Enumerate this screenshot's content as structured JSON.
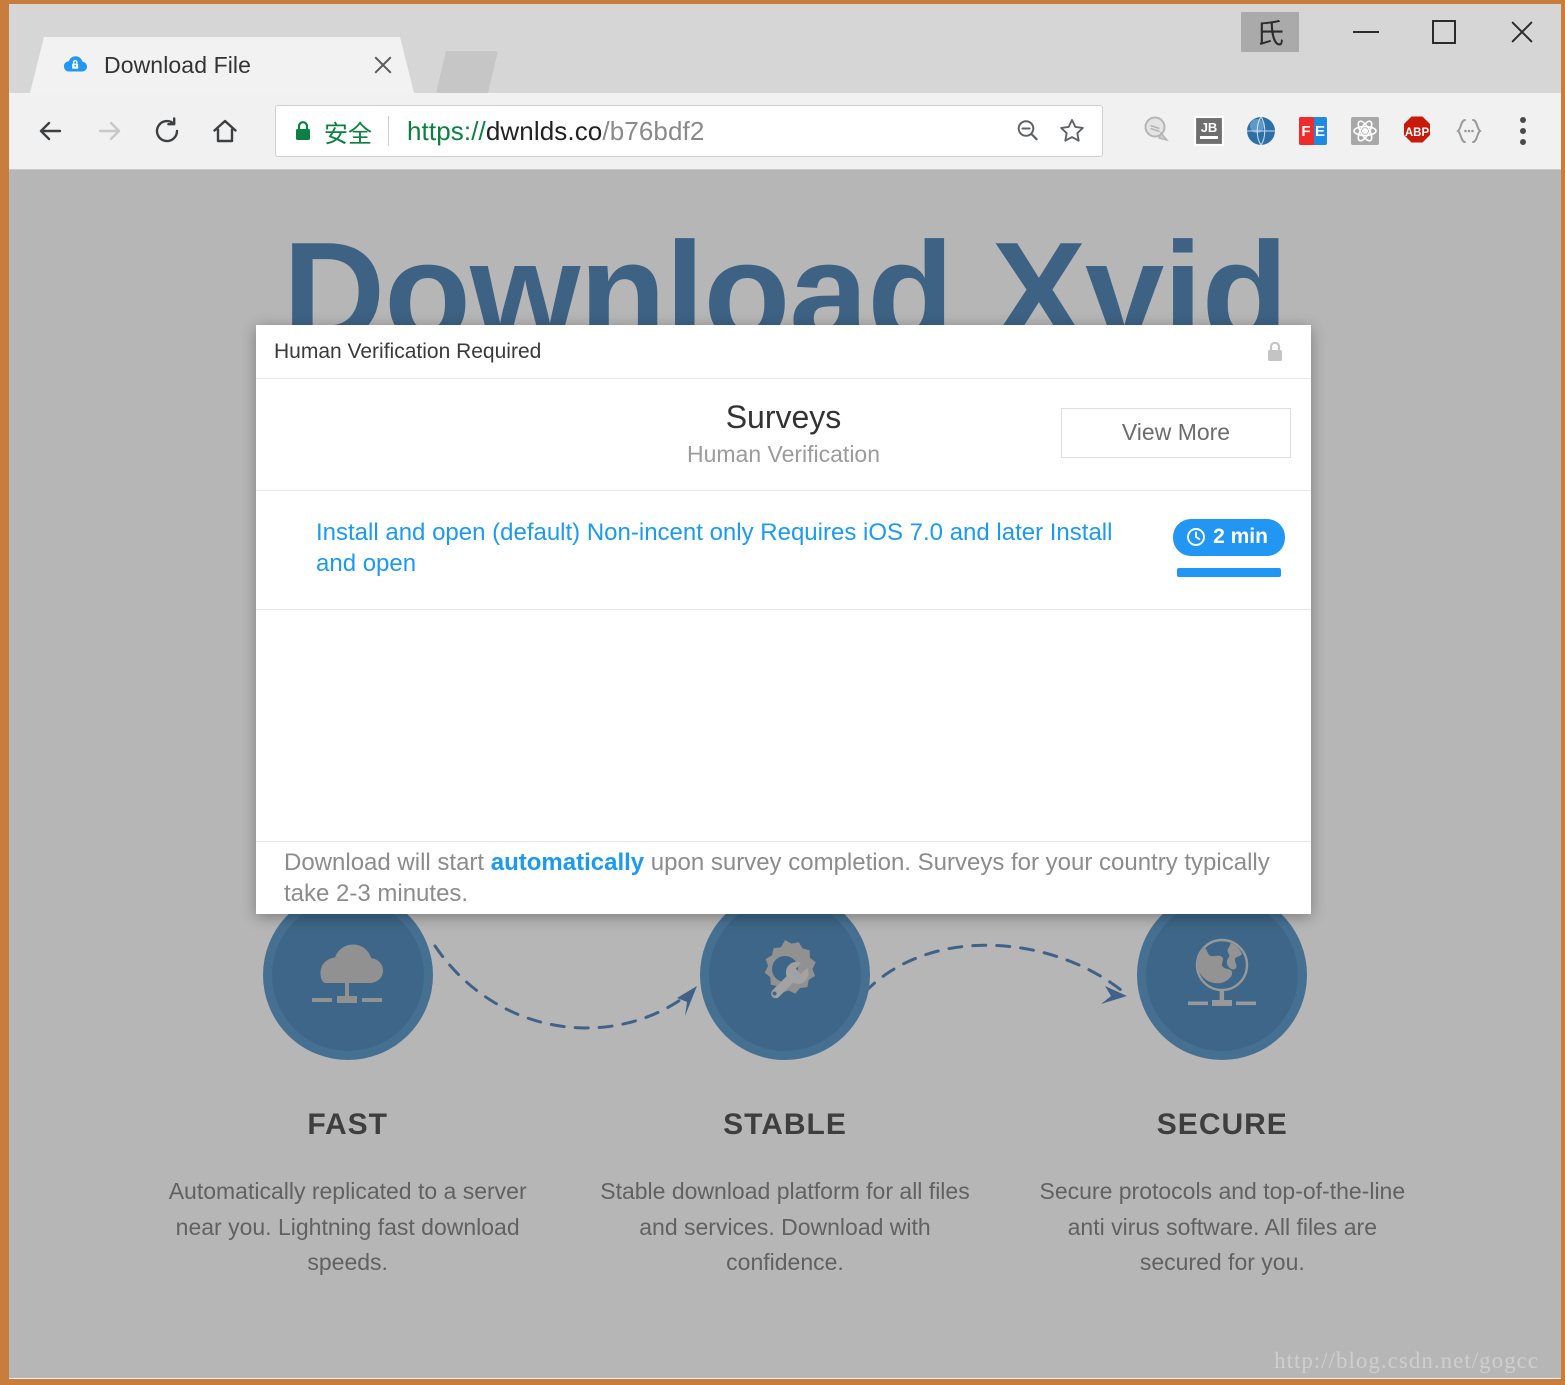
{
  "window": {
    "ime_badge": "氏",
    "minimize_label": "Minimize",
    "maximize_label": "Maximize",
    "close_label": "Close"
  },
  "browser": {
    "tab": {
      "title": "Download File",
      "favicon": "cloud-lock-icon",
      "close_label": "Close tab"
    },
    "nav": {
      "back": "back-arrow-icon",
      "forward": "forward-arrow-icon",
      "reload": "reload-icon",
      "home": "home-icon"
    },
    "omnibox": {
      "security_label": "安全",
      "url_scheme": "https://",
      "url_host": "dwnlds.co",
      "url_path": "/b76bdf2",
      "full_url": "https://dwnlds.co/b76bdf2",
      "zoom_icon": "zoom-out-icon",
      "bookmark_icon": "star-icon"
    },
    "extensions": [
      {
        "name": "pocket-extension",
        "label": ""
      },
      {
        "name": "jetbrains-extension",
        "label": "JB"
      },
      {
        "name": "globe-extension",
        "label": ""
      },
      {
        "name": "fe-extension",
        "label": "FE"
      },
      {
        "name": "react-devtools-extension",
        "label": ""
      },
      {
        "name": "adblock-plus-extension",
        "label": "ABP"
      },
      {
        "name": "json-viewer-extension",
        "label": "{…}"
      }
    ],
    "menu_label": "Customize and control Google Chrome"
  },
  "page": {
    "hero_title": "Download Xvid",
    "watermark": "http://blog.csdn.net/gogcc",
    "features": [
      {
        "icon": "cloud-network-icon",
        "title": "FAST",
        "desc": "Automatically replicated to a server near you. Lightning fast download speeds."
      },
      {
        "icon": "gear-wrench-icon",
        "title": "STABLE",
        "desc": "Stable download platform for all files and services. Download with confidence."
      },
      {
        "icon": "globe-network-icon",
        "title": "SECURE",
        "desc": "Secure protocols and top-of-the-line anti virus software. All files are secured for you."
      }
    ]
  },
  "modal": {
    "header_title": "Human Verification Required",
    "header_lock_icon": "padlock-icon",
    "surveys_heading": "Surveys",
    "surveys_subheading": "Human Verification",
    "view_more_label": "View More",
    "survey": {
      "link_text": "Install and open (default) Non-incent only Requires iOS 7.0 and later Install and open",
      "time_badge": "2 min",
      "clock_icon": "clock-icon"
    },
    "footer_prefix": "Download will start ",
    "footer_highlight": "automatically",
    "footer_suffix": " upon survey completion. Surveys for your country typically take 2-3 minutes."
  },
  "colors": {
    "frame_orange": "#c87d3c",
    "accent_blue": "#2196f3",
    "link_blue": "#1b9bf0",
    "brand_blue": "#1a5fa0",
    "secure_green": "#0b8043",
    "dim_overlay": "#666666"
  }
}
